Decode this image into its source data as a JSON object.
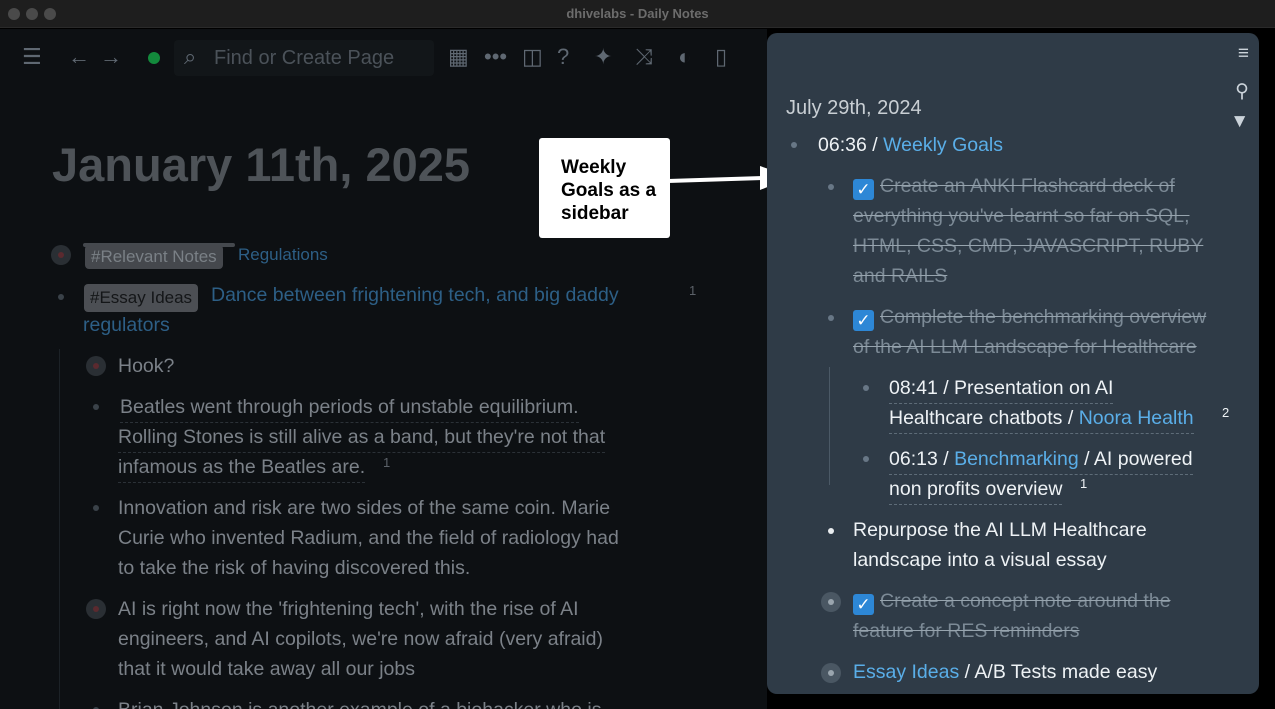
{
  "window": {
    "title": "dhivelabs - Daily Notes"
  },
  "toolbar": {
    "search_placeholder": "Find or Create Page",
    "icons": [
      "menu-icon",
      "back-arrow-icon",
      "forward-arrow-icon",
      "sync-status-icon",
      "search-icon",
      "calendar-icon",
      "more-icon",
      "sidebar-icon",
      "help-icon",
      "sparkle-icon",
      "shuffle-icon",
      "toggle-icon",
      "book-icon"
    ],
    "status_color": "#138a3c"
  },
  "main": {
    "title": "January 11th, 2025",
    "block1": {
      "tag": "#Relevant Notes",
      "link": "Regulations"
    },
    "block2": {
      "tag": "#Essay Ideas",
      "line1": "Dance between frightening tech, and big daddy",
      "line2": "regulators",
      "ref": "1"
    },
    "hook": "Hook?",
    "para1": {
      "l1": "Beatles went through periods of unstable equilibrium.",
      "l2": "Rolling Stones is still alive as a band, but they're not that",
      "l3": "infamous as the Beatles are.",
      "ref": "1"
    },
    "para2": {
      "l1": "Innovation and risk are two sides of the same coin. Marie",
      "l2": "Curie who invented Radium, and the field of radiology had",
      "l3": "to take the risk of having discovered this."
    },
    "para3": {
      "l1": "AI is right now the 'frightening tech', with the rise of AI",
      "l2": "engineers, and AI copilots, we're now afraid (very afraid)",
      "l3": "that it would take away all our jobs"
    },
    "para4": {
      "l1": "Brian Johnson is another example of a biohacker who is"
    }
  },
  "callout": {
    "line1": "Weekly",
    "line2": "Goals as a",
    "line3": "sidebar"
  },
  "sidebar": {
    "date": "July 29th, 2024",
    "root": {
      "time": "06:36",
      "sep": " / ",
      "link": "Weekly Goals"
    },
    "task1": {
      "l1": "Create an ANKI Flashcard deck of",
      "l2": "everything you've learnt so far on SQL,",
      "l3": "HTML, CSS, CMD, JAVASCRIPT, RUBY",
      "l4": "and RAILS"
    },
    "task2": {
      "l1": "Complete the benchmarking overview",
      "l2": "of the AI LLM Landscape for Healthcare"
    },
    "sub1": {
      "l1": "08:41 / Presentation on AI",
      "l2a": "Healthcare chatbots / ",
      "link": "Noora Health",
      "ref": "2"
    },
    "sub2": {
      "time": "06:13 / ",
      "link": "Benchmarking",
      "rest": " / AI powered",
      "l2": "non profits overview",
      "ref": "1"
    },
    "task3": {
      "l1": "Repurpose the AI LLM Healthcare",
      "l2": "landscape into a visual essay"
    },
    "task4": {
      "l1": "Create a concept note around the",
      "l2": "feature for RES reminders"
    },
    "task5": {
      "link": "Essay Ideas",
      "rest": " / A/B Tests made easy"
    },
    "accent": "#5aaee8",
    "checkbox_color": "#2d87d6"
  }
}
